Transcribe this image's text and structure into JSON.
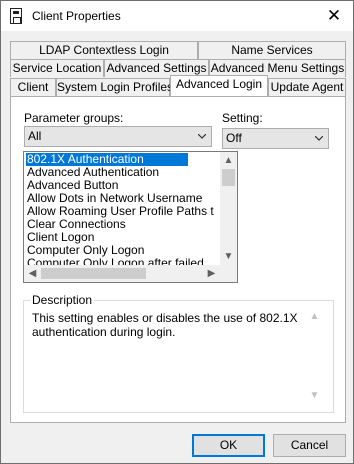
{
  "window": {
    "title": "Client Properties",
    "close_glyph": "✕"
  },
  "tabs": {
    "row1": [
      "LDAP Contextless Login",
      "Name Services"
    ],
    "row2": [
      "Service Location",
      "Advanced Settings",
      "Advanced Menu Settings"
    ],
    "row3": [
      "Client",
      "System Login Profiles",
      "Advanced Login",
      "Update Agent"
    ],
    "active": "Advanced Login"
  },
  "parameters": {
    "groups_label": "Parameter groups:",
    "groups_value": "All",
    "setting_label": "Setting:",
    "setting_value": "Off",
    "items": [
      "802.1X Authentication",
      "Advanced Authentication",
      "Advanced Button",
      "Allow Dots in Network Username",
      "Allow Roaming User Profile Paths t",
      "Clear Connections",
      "Client Logon",
      "Computer Only Logon",
      "Computer Only Logon after failed"
    ],
    "selected_item": "802.1X Authentication"
  },
  "description": {
    "label": "Description",
    "text": "This setting enables or disables the use of 802.1X authentication during login."
  },
  "buttons": {
    "ok": "OK",
    "cancel": "Cancel"
  },
  "colors": {
    "selection": "#0078d7",
    "dialog_bg": "#f0f0f0"
  }
}
